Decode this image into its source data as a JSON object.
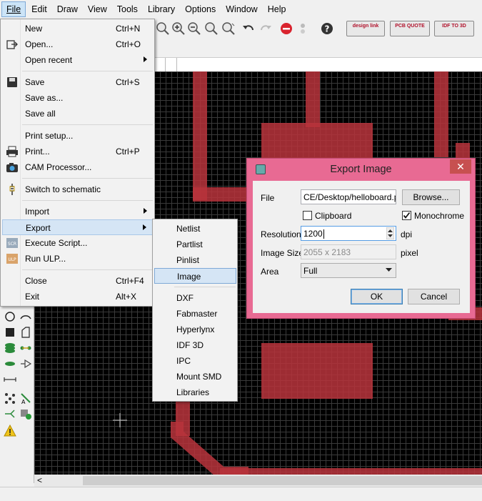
{
  "menubar": {
    "items": [
      {
        "label": "File"
      },
      {
        "label": "Edit"
      },
      {
        "label": "Draw"
      },
      {
        "label": "View"
      },
      {
        "label": "Tools"
      },
      {
        "label": "Library"
      },
      {
        "label": "Options"
      },
      {
        "label": "Window"
      },
      {
        "label": "Help"
      }
    ]
  },
  "toolbar": {
    "badges": [
      "design link",
      "PCB QUOTE",
      "IDF TO 3D"
    ]
  },
  "file_menu": {
    "items": [
      {
        "label": "New",
        "shortcut": "Ctrl+N"
      },
      {
        "label": "Open...",
        "shortcut": "Ctrl+O"
      },
      {
        "label": "Open recent",
        "shortcut": ""
      },
      {
        "label": "Save",
        "shortcut": "Ctrl+S"
      },
      {
        "label": "Save as...",
        "shortcut": ""
      },
      {
        "label": "Save all",
        "shortcut": ""
      },
      {
        "label": "Print setup...",
        "shortcut": ""
      },
      {
        "label": "Print...",
        "shortcut": "Ctrl+P"
      },
      {
        "label": "CAM Processor...",
        "shortcut": ""
      },
      {
        "label": "Switch to schematic",
        "shortcut": ""
      },
      {
        "label": "Import",
        "shortcut": ""
      },
      {
        "label": "Export",
        "shortcut": ""
      },
      {
        "label": "Execute Script...",
        "shortcut": ""
      },
      {
        "label": "Run ULP...",
        "shortcut": ""
      },
      {
        "label": "Close",
        "shortcut": "Ctrl+F4"
      },
      {
        "label": "Exit",
        "shortcut": "Alt+X"
      }
    ]
  },
  "export_submenu": {
    "items": [
      "Netlist",
      "Partlist",
      "Pinlist",
      "Image",
      "DXF",
      "Fabmaster",
      "Hyperlynx",
      "IDF 3D",
      "IPC",
      "Mount SMD",
      "Libraries"
    ]
  },
  "export_dialog": {
    "title": "Export Image",
    "close_glyph": "✕",
    "file_label": "File",
    "file_value": "CE/Desktop/helloboard.png",
    "browse_label": "Browse...",
    "clipboard_label": "Clipboard",
    "clipboard_checked": false,
    "monochrome_label": "Monochrome",
    "monochrome_checked": true,
    "resolution_label": "Resolution",
    "resolution_value": "1200",
    "resolution_unit": "dpi",
    "image_size_label": "Image Size",
    "image_size_value": "2055 x 2183",
    "image_size_unit": "pixel",
    "area_label": "Area",
    "area_value": "Full",
    "ok_label": "OK",
    "cancel_label": "Cancel"
  },
  "scroll": {
    "left_arrow": "<"
  },
  "colors": {
    "dialog_title": "#e86a93",
    "trace": "#b8343c",
    "menu_highlight": "#d5e5f5"
  }
}
